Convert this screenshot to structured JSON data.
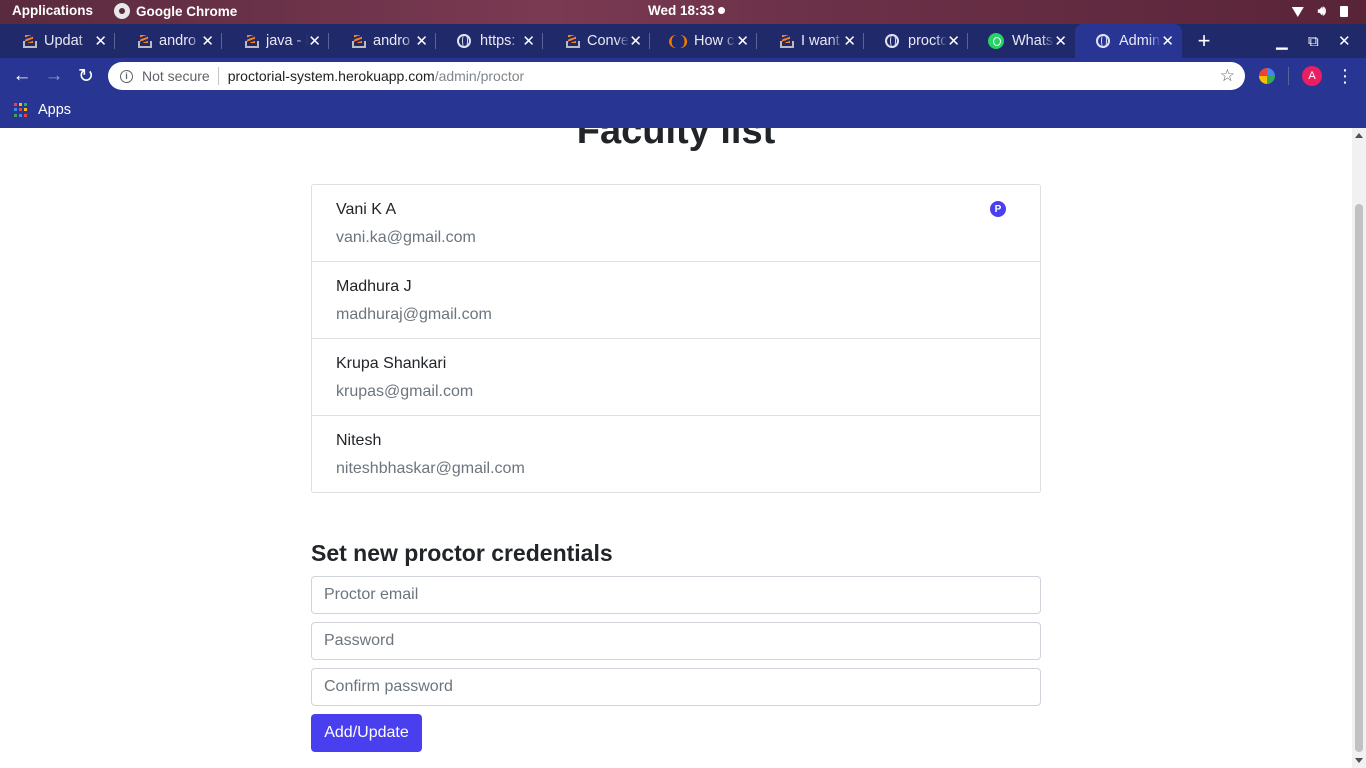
{
  "system_bar": {
    "applications": "Applications",
    "active_app": "Google Chrome",
    "clock": "Wed 18:33"
  },
  "tabs": [
    {
      "label": "Updat",
      "icon": "stackoverflow-icon"
    },
    {
      "label": "andro",
      "icon": "stackoverflow-icon"
    },
    {
      "label": "java - R",
      "icon": "stackoverflow-icon"
    },
    {
      "label": "andro",
      "icon": "stackoverflow-icon"
    },
    {
      "label": "https:",
      "icon": "globe-icon"
    },
    {
      "label": "Conve",
      "icon": "stackoverflow-icon"
    },
    {
      "label": "How c",
      "icon": "hand-icon"
    },
    {
      "label": "I want",
      "icon": "stackoverflow-icon"
    },
    {
      "label": "procto",
      "icon": "globe-icon"
    },
    {
      "label": "Whats",
      "icon": "whatsapp-icon"
    },
    {
      "label": "Admin",
      "icon": "globe-icon",
      "active": true
    }
  ],
  "address_bar": {
    "security": "Not secure",
    "host": "proctorial-system.herokuapp.com",
    "path": "/admin/proctor"
  },
  "bookmarks": {
    "apps_label": "Apps"
  },
  "profile": {
    "initial": "A",
    "color": "#e91e63"
  },
  "page": {
    "title": "Faculty list",
    "faculty": [
      {
        "name": "Vani K A",
        "email": "vani.ka@gmail.com",
        "badge": "P"
      },
      {
        "name": "Madhura J",
        "email": "madhuraj@gmail.com"
      },
      {
        "name": "Krupa Shankari",
        "email": "krupas@gmail.com"
      },
      {
        "name": "Nitesh",
        "email": "niteshbhaskar@gmail.com"
      }
    ],
    "form": {
      "title": "Set new proctor credentials",
      "email_placeholder": "Proctor email",
      "password_placeholder": "Password",
      "confirm_placeholder": "Confirm password",
      "submit_label": "Add/Update"
    }
  },
  "colors": {
    "accent": "#4a3fef",
    "browser_chrome": "#283593",
    "tab_strip": "#202a6a"
  }
}
